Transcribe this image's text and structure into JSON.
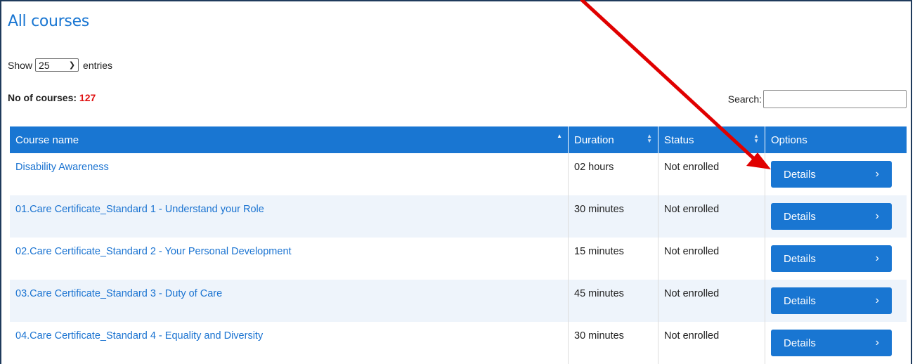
{
  "page": {
    "title": "All courses",
    "show_label": "Show",
    "entries_value": "25",
    "entries_label": "entries",
    "count_label": "No of courses:",
    "count_value": "127",
    "search_label": "Search:",
    "search_value": ""
  },
  "table": {
    "headers": {
      "course_name": "Course name",
      "duration": "Duration",
      "status": "Status",
      "options": "Options"
    },
    "rows": [
      {
        "name": "Disability Awareness",
        "duration": "02 hours",
        "status": "Not enrolled",
        "button": "Details"
      },
      {
        "name": "01.Care Certificate_Standard 1 - Understand your Role",
        "duration": "30 minutes",
        "status": "Not enrolled",
        "button": "Details"
      },
      {
        "name": "02.Care Certificate_Standard 2 - Your Personal Development",
        "duration": "15 minutes",
        "status": "Not enrolled",
        "button": "Details"
      },
      {
        "name": "03.Care Certificate_Standard 3 - Duty of Care",
        "duration": "45 minutes",
        "status": "Not enrolled",
        "button": "Details"
      },
      {
        "name": "04.Care Certificate_Standard 4 - Equality and Diversity",
        "duration": "30 minutes",
        "status": "Not enrolled",
        "button": "Details"
      }
    ]
  },
  "colors": {
    "accent": "#1976d2",
    "count_highlight": "#e01010",
    "annotation_arrow": "#e00000"
  },
  "icons": {
    "select_chevron": "chevron-down-icon",
    "sort": "sort-icon",
    "details_chevron": "chevron-right-icon",
    "annotation": "red-arrow-annotation"
  }
}
